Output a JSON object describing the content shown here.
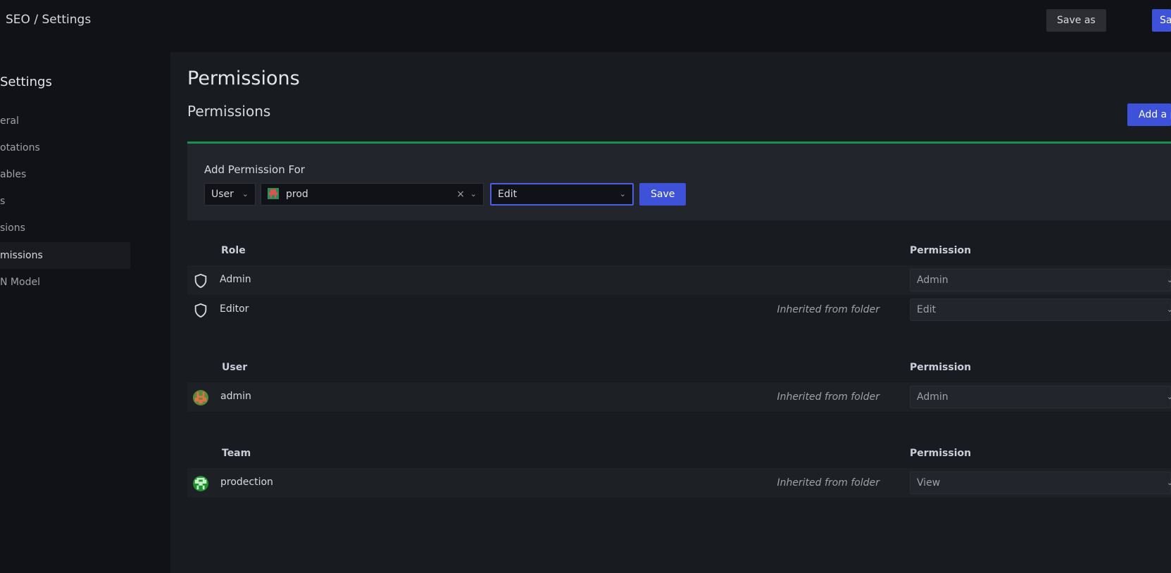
{
  "header": {
    "breadcrumb": "SEO / Settings",
    "save_as_label": "Save as",
    "save_label": "Save"
  },
  "sidebar": {
    "title": "Settings",
    "items": [
      {
        "label": "eral"
      },
      {
        "label": "otations"
      },
      {
        "label": "ables"
      },
      {
        "label": "s"
      },
      {
        "label": "sions"
      },
      {
        "label": "missions",
        "active": true
      },
      {
        "label": "N Model"
      }
    ]
  },
  "main": {
    "page_title": "Permissions",
    "section_title": "Permissions",
    "add_permission_button": "Add a p",
    "add_panel": {
      "label": "Add Permission For",
      "type_select": "User",
      "user_select": "prod",
      "permission_select": "Edit",
      "save_label": "Save"
    },
    "roles": {
      "header": "Role",
      "permission_header": "Permission",
      "rows": [
        {
          "name": "Admin",
          "inherited": "",
          "permission": "Admin"
        },
        {
          "name": "Editor",
          "inherited": "Inherited from folder",
          "permission": "Edit"
        }
      ]
    },
    "users": {
      "header": "User",
      "permission_header": "Permission",
      "rows": [
        {
          "name": "admin",
          "inherited": "Inherited from folder",
          "permission": "Admin"
        }
      ]
    },
    "teams": {
      "header": "Team",
      "permission_header": "Permission",
      "rows": [
        {
          "name": "prodection",
          "inherited": "Inherited from folder",
          "permission": "View"
        }
      ]
    }
  },
  "colors": {
    "background": "#111217",
    "panel": "#181b1f",
    "primary": "#3d52d9",
    "success": "#1a9150"
  }
}
